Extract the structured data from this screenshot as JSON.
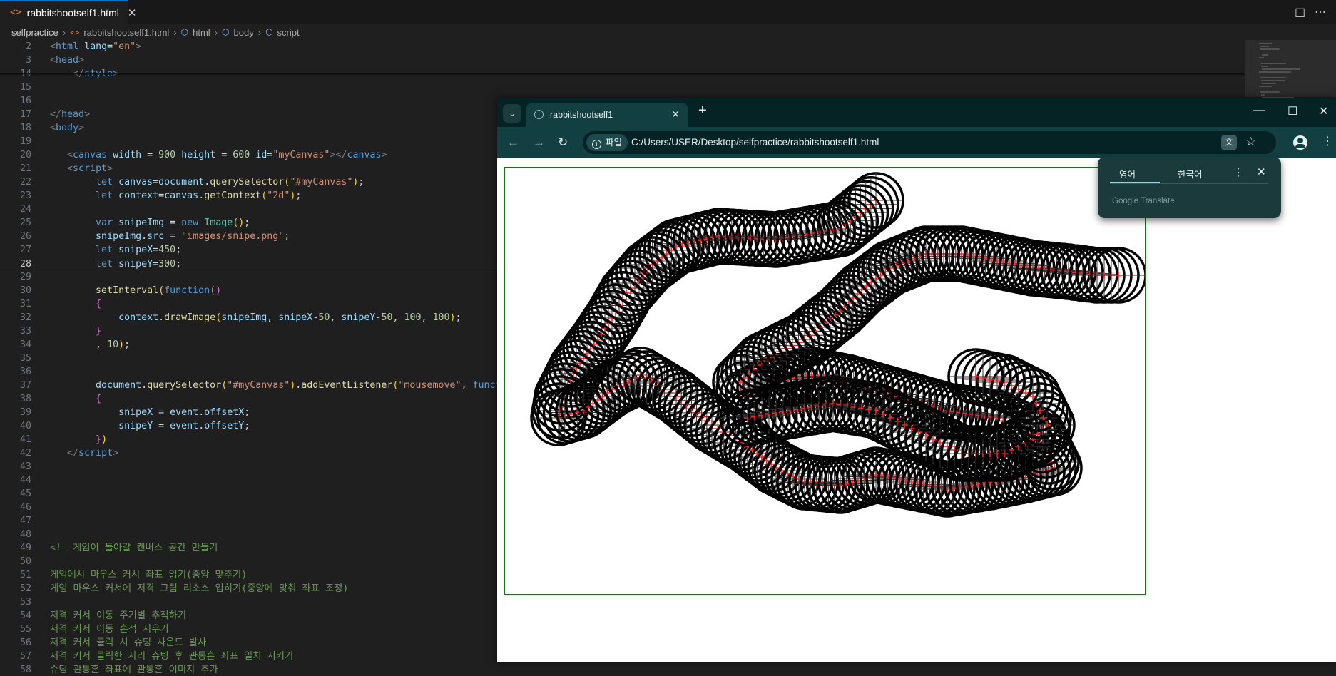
{
  "editor": {
    "tab": {
      "filename": "rabbitshootself1.html",
      "icon": "html-file-icon",
      "close": "✕"
    },
    "breadcrumb": [
      "selfpractice",
      "rabbitshootself1.html",
      "html",
      "body",
      "script"
    ],
    "lines": [
      {
        "n": "2",
        "sticky": true,
        "tokens": [
          [
            "t-punc",
            "<"
          ],
          [
            "t-tag",
            "html"
          ],
          [
            "t-plain",
            " "
          ],
          [
            "t-attr",
            "lang"
          ],
          [
            "t-plain",
            "="
          ],
          [
            "t-str",
            "\"en\""
          ],
          [
            "t-punc",
            ">"
          ]
        ]
      },
      {
        "n": "3",
        "sticky": true,
        "tokens": [
          [
            "t-punc",
            "<"
          ],
          [
            "t-tag",
            "head"
          ],
          [
            "t-punc",
            ">"
          ]
        ]
      },
      {
        "n": "14",
        "tokens": [
          [
            "t-plain",
            "    "
          ],
          [
            "t-punc",
            "</"
          ],
          [
            "t-tag",
            "style"
          ],
          [
            "t-punc",
            ">"
          ]
        ]
      },
      {
        "n": "15",
        "tokens": []
      },
      {
        "n": "16",
        "tokens": []
      },
      {
        "n": "17",
        "tokens": [
          [
            "t-punc",
            "</"
          ],
          [
            "t-tag",
            "head"
          ],
          [
            "t-punc",
            ">"
          ]
        ]
      },
      {
        "n": "18",
        "tokens": [
          [
            "t-punc",
            "<"
          ],
          [
            "t-tag",
            "body"
          ],
          [
            "t-punc",
            ">"
          ]
        ]
      },
      {
        "n": "19",
        "tokens": []
      },
      {
        "n": "20",
        "tokens": [
          [
            "t-plain",
            "   "
          ],
          [
            "t-punc",
            "<"
          ],
          [
            "t-tag",
            "canvas"
          ],
          [
            "t-plain",
            " "
          ],
          [
            "t-attr",
            "width"
          ],
          [
            "t-plain",
            " = "
          ],
          [
            "t-num",
            "900"
          ],
          [
            "t-plain",
            " "
          ],
          [
            "t-attr",
            "height"
          ],
          [
            "t-plain",
            " = "
          ],
          [
            "t-num",
            "600"
          ],
          [
            "t-plain",
            " "
          ],
          [
            "t-attr",
            "id"
          ],
          [
            "t-plain",
            "="
          ],
          [
            "t-str",
            "\"myCanvas\""
          ],
          [
            "t-punc",
            "></"
          ],
          [
            "t-tag",
            "canvas"
          ],
          [
            "t-punc",
            ">"
          ]
        ]
      },
      {
        "n": "21",
        "tokens": [
          [
            "t-plain",
            "   "
          ],
          [
            "t-punc",
            "<"
          ],
          [
            "t-tag",
            "script"
          ],
          [
            "t-punc",
            ">"
          ]
        ]
      },
      {
        "n": "22",
        "tokens": [
          [
            "t-plain",
            "        "
          ],
          [
            "t-kw",
            "let"
          ],
          [
            "t-plain",
            " "
          ],
          [
            "t-var",
            "canvas"
          ],
          [
            "t-plain",
            "="
          ],
          [
            "t-var",
            "document"
          ],
          [
            "t-plain",
            "."
          ],
          [
            "t-fn",
            "querySelector"
          ],
          [
            "t-br2",
            "("
          ],
          [
            "t-str",
            "\"#myCanvas\""
          ],
          [
            "t-br2",
            ")"
          ],
          [
            "t-plain",
            ";"
          ]
        ]
      },
      {
        "n": "23",
        "tokens": [
          [
            "t-plain",
            "        "
          ],
          [
            "t-kw",
            "let"
          ],
          [
            "t-plain",
            " "
          ],
          [
            "t-var",
            "context"
          ],
          [
            "t-plain",
            "="
          ],
          [
            "t-var",
            "canvas"
          ],
          [
            "t-plain",
            "."
          ],
          [
            "t-fn",
            "getContext"
          ],
          [
            "t-br2",
            "("
          ],
          [
            "t-str",
            "\"2d\""
          ],
          [
            "t-br2",
            ")"
          ],
          [
            "t-plain",
            ";"
          ]
        ]
      },
      {
        "n": "24",
        "tokens": []
      },
      {
        "n": "25",
        "tokens": [
          [
            "t-plain",
            "        "
          ],
          [
            "t-kw",
            "var"
          ],
          [
            "t-plain",
            " "
          ],
          [
            "t-var",
            "snipeImg"
          ],
          [
            "t-plain",
            " = "
          ],
          [
            "t-kw",
            "new"
          ],
          [
            "t-plain",
            " "
          ],
          [
            "t-cls",
            "Image"
          ],
          [
            "t-br2",
            "()"
          ],
          [
            "t-plain",
            ";"
          ]
        ]
      },
      {
        "n": "26",
        "tokens": [
          [
            "t-plain",
            "        "
          ],
          [
            "t-var",
            "snipeImg"
          ],
          [
            "t-plain",
            "."
          ],
          [
            "t-var",
            "src"
          ],
          [
            "t-plain",
            " = "
          ],
          [
            "t-str",
            "\"images/snipe.png\""
          ],
          [
            "t-plain",
            ";"
          ]
        ]
      },
      {
        "n": "27",
        "tokens": [
          [
            "t-plain",
            "        "
          ],
          [
            "t-kw",
            "let"
          ],
          [
            "t-plain",
            " "
          ],
          [
            "t-var",
            "snipeX"
          ],
          [
            "t-plain",
            "="
          ],
          [
            "t-num",
            "450"
          ],
          [
            "t-plain",
            ";"
          ]
        ]
      },
      {
        "n": "28",
        "active": true,
        "tokens": [
          [
            "t-plain",
            "        "
          ],
          [
            "t-kw",
            "let"
          ],
          [
            "t-plain",
            " "
          ],
          [
            "t-var",
            "snipeY"
          ],
          [
            "t-plain",
            "="
          ],
          [
            "t-num",
            "300"
          ],
          [
            "t-plain",
            ";"
          ]
        ]
      },
      {
        "n": "29",
        "tokens": []
      },
      {
        "n": "30",
        "tokens": [
          [
            "t-plain",
            "        "
          ],
          [
            "t-fn",
            "setInterval"
          ],
          [
            "t-br2",
            "("
          ],
          [
            "t-kw",
            "function"
          ],
          [
            "t-br",
            "()"
          ]
        ]
      },
      {
        "n": "31",
        "tokens": [
          [
            "t-plain",
            "        "
          ],
          [
            "t-br",
            "{"
          ]
        ]
      },
      {
        "n": "32",
        "tokens": [
          [
            "t-plain",
            "            "
          ],
          [
            "t-var",
            "context"
          ],
          [
            "t-plain",
            "."
          ],
          [
            "t-fn",
            "drawImage"
          ],
          [
            "t-br2",
            "("
          ],
          [
            "t-var",
            "snipeImg"
          ],
          [
            "t-plain",
            ", "
          ],
          [
            "t-var",
            "snipeX"
          ],
          [
            "t-plain",
            "-"
          ],
          [
            "t-num",
            "50"
          ],
          [
            "t-plain",
            ", "
          ],
          [
            "t-var",
            "snipeY"
          ],
          [
            "t-plain",
            "-"
          ],
          [
            "t-num",
            "50"
          ],
          [
            "t-plain",
            ", "
          ],
          [
            "t-num",
            "100"
          ],
          [
            "t-plain",
            ", "
          ],
          [
            "t-num",
            "100"
          ],
          [
            "t-br2",
            ")"
          ],
          [
            "t-plain",
            ";"
          ]
        ]
      },
      {
        "n": "33",
        "tokens": [
          [
            "t-plain",
            "        "
          ],
          [
            "t-br",
            "}"
          ]
        ]
      },
      {
        "n": "34",
        "tokens": [
          [
            "t-plain",
            "        , "
          ],
          [
            "t-num",
            "10"
          ],
          [
            "t-br2",
            ")"
          ],
          [
            "t-plain",
            ";"
          ]
        ]
      },
      {
        "n": "35",
        "tokens": []
      },
      {
        "n": "36",
        "tokens": []
      },
      {
        "n": "37",
        "tokens": [
          [
            "t-plain",
            "        "
          ],
          [
            "t-var",
            "document"
          ],
          [
            "t-plain",
            "."
          ],
          [
            "t-fn",
            "querySelector"
          ],
          [
            "t-br2",
            "("
          ],
          [
            "t-str",
            "\"#myCanvas\""
          ],
          [
            "t-br2",
            ")"
          ],
          [
            "t-plain",
            "."
          ],
          [
            "t-fn",
            "addEventListener"
          ],
          [
            "t-br2",
            "("
          ],
          [
            "t-str",
            "\"mousemove\""
          ],
          [
            "t-plain",
            ", "
          ],
          [
            "t-kw",
            "function"
          ]
        ]
      },
      {
        "n": "38",
        "tokens": [
          [
            "t-plain",
            "        "
          ],
          [
            "t-br",
            "{"
          ]
        ]
      },
      {
        "n": "39",
        "tokens": [
          [
            "t-plain",
            "            "
          ],
          [
            "t-var",
            "snipeX"
          ],
          [
            "t-plain",
            " = "
          ],
          [
            "t-var",
            "event"
          ],
          [
            "t-plain",
            "."
          ],
          [
            "t-var",
            "offsetX"
          ],
          [
            "t-plain",
            ";"
          ]
        ]
      },
      {
        "n": "40",
        "tokens": [
          [
            "t-plain",
            "            "
          ],
          [
            "t-var",
            "snipeY"
          ],
          [
            "t-plain",
            " = "
          ],
          [
            "t-var",
            "event"
          ],
          [
            "t-plain",
            "."
          ],
          [
            "t-var",
            "offsetY"
          ],
          [
            "t-plain",
            ";"
          ]
        ]
      },
      {
        "n": "41",
        "tokens": [
          [
            "t-plain",
            "        "
          ],
          [
            "t-br",
            "}"
          ],
          [
            "t-br2",
            ")"
          ]
        ]
      },
      {
        "n": "42",
        "tokens": [
          [
            "t-plain",
            "   "
          ],
          [
            "t-punc",
            "</"
          ],
          [
            "t-tag",
            "script"
          ],
          [
            "t-punc",
            ">"
          ]
        ]
      },
      {
        "n": "43",
        "tokens": []
      },
      {
        "n": "44",
        "tokens": []
      },
      {
        "n": "45",
        "tokens": []
      },
      {
        "n": "46",
        "tokens": []
      },
      {
        "n": "47",
        "tokens": []
      },
      {
        "n": "48",
        "tokens": []
      },
      {
        "n": "49",
        "tokens": [
          [
            "t-com",
            "<!--게임이 돌아갈 캔버스 공간 만들기"
          ]
        ]
      },
      {
        "n": "50",
        "tokens": []
      },
      {
        "n": "51",
        "tokens": [
          [
            "t-com",
            "게임에서 마우스 커서 좌표 읽기(중앙 맞추기)"
          ]
        ]
      },
      {
        "n": "52",
        "tokens": [
          [
            "t-com",
            "게임 마우스 커서에 저격 그림 리소스 입히기(중앙에 맞춰 좌표 조정)"
          ]
        ]
      },
      {
        "n": "53",
        "tokens": []
      },
      {
        "n": "54",
        "tokens": [
          [
            "t-com",
            "저격 커서 이동 주기별 추적하기"
          ]
        ]
      },
      {
        "n": "55",
        "tokens": [
          [
            "t-com",
            "저격 커서 이동 흔적 지우기"
          ]
        ]
      },
      {
        "n": "56",
        "tokens": [
          [
            "t-com",
            "저격 커서 클릭 시 슈팅 사운드 발사"
          ]
        ]
      },
      {
        "n": "57",
        "tokens": [
          [
            "t-com",
            "저격 커서 클릭한 자리 슈팅 후 관통흔 좌표 일치 시키기"
          ]
        ]
      },
      {
        "n": "58",
        "tokens": [
          [
            "t-com",
            "슈팅 관통흔 좌표에 관통흔 이미지 추가"
          ]
        ]
      }
    ]
  },
  "browser": {
    "tab_title": "rabbitshootself1",
    "chip_label": "파일",
    "url": "C:/Users/USER/Desktop/selfpractice/rabbitshootself1.html",
    "translate": {
      "source_lang": "영어",
      "target_lang": "한국어",
      "brand_google": "Google",
      "brand_translate": "Translate"
    }
  }
}
